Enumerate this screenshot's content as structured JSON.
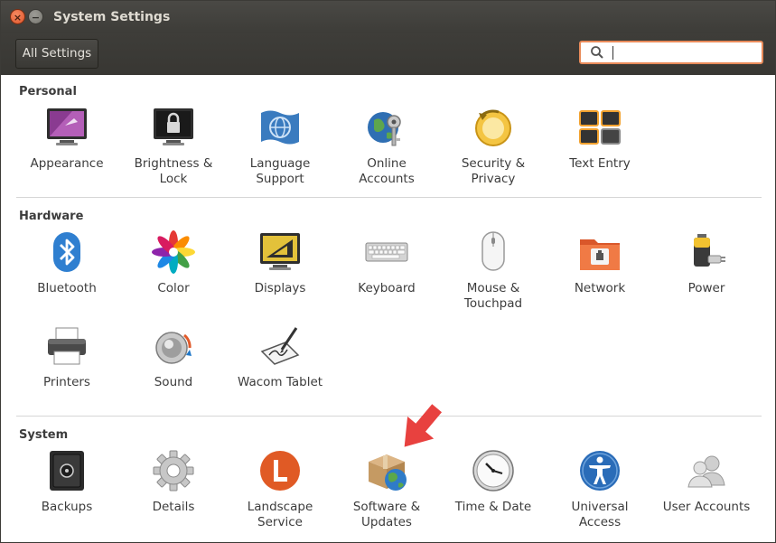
{
  "window": {
    "title": "System Settings",
    "close_glyph": "×",
    "minimize_glyph": "−"
  },
  "toolbar": {
    "all_settings_label": "All Settings",
    "search": {
      "value": "",
      "placeholder": ""
    }
  },
  "sections": {
    "personal": {
      "title": "Personal",
      "items": [
        {
          "line1": "Appearance",
          "line2": "",
          "icon": "appearance-icon"
        },
        {
          "line1": "Brightness &",
          "line2": "Lock",
          "icon": "brightness-lock-icon"
        },
        {
          "line1": "Language",
          "line2": "Support",
          "icon": "language-support-icon"
        },
        {
          "line1": "Online",
          "line2": "Accounts",
          "icon": "online-accounts-icon"
        },
        {
          "line1": "Security &",
          "line2": "Privacy",
          "icon": "security-privacy-icon"
        },
        {
          "line1": "Text Entry",
          "line2": "",
          "icon": "text-entry-icon"
        }
      ]
    },
    "hardware": {
      "title": "Hardware",
      "items": [
        {
          "line1": "Bluetooth",
          "line2": "",
          "icon": "bluetooth-icon"
        },
        {
          "line1": "Color",
          "line2": "",
          "icon": "color-icon"
        },
        {
          "line1": "Displays",
          "line2": "",
          "icon": "displays-icon"
        },
        {
          "line1": "Keyboard",
          "line2": "",
          "icon": "keyboard-icon"
        },
        {
          "line1": "Mouse &",
          "line2": "Touchpad",
          "icon": "mouse-touchpad-icon"
        },
        {
          "line1": "Network",
          "line2": "",
          "icon": "network-icon"
        },
        {
          "line1": "Power",
          "line2": "",
          "icon": "power-icon"
        },
        {
          "line1": "Printers",
          "line2": "",
          "icon": "printers-icon"
        },
        {
          "line1": "Sound",
          "line2": "",
          "icon": "sound-icon"
        },
        {
          "line1": "Wacom Tablet",
          "line2": "",
          "icon": "wacom-tablet-icon"
        }
      ]
    },
    "system": {
      "title": "System",
      "items": [
        {
          "line1": "Backups",
          "line2": "",
          "icon": "backups-icon"
        },
        {
          "line1": "Details",
          "line2": "",
          "icon": "details-icon"
        },
        {
          "line1": "Landscape",
          "line2": "Service",
          "icon": "landscape-service-icon"
        },
        {
          "line1": "Software &",
          "line2": "Updates",
          "icon": "software-updates-icon"
        },
        {
          "line1": "Time & Date",
          "line2": "",
          "icon": "time-date-icon"
        },
        {
          "line1": "Universal",
          "line2": "Access",
          "icon": "universal-access-icon"
        },
        {
          "line1": "User Accounts",
          "line2": "",
          "icon": "user-accounts-icon"
        }
      ]
    }
  },
  "colors": {
    "accent": "#e95420",
    "annotation_arrow": "#e8413f"
  }
}
